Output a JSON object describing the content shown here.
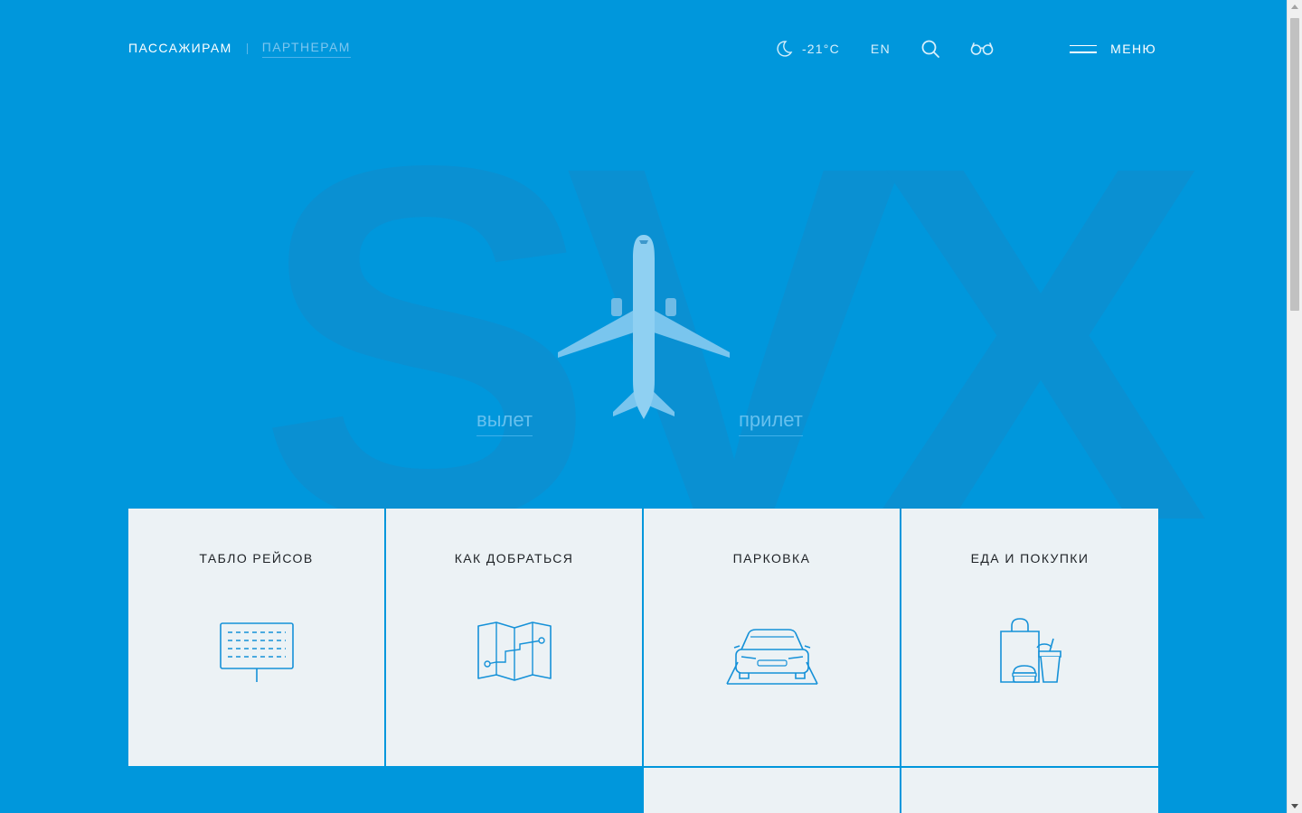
{
  "header": {
    "nav": [
      {
        "label": "ПАССАЖИРАМ",
        "active": true
      },
      {
        "label": "ПАРТНЕРАМ",
        "active": false
      }
    ],
    "weather": {
      "icon": "moon-icon",
      "temperature": "-21°C"
    },
    "language": "EN",
    "menu_label": "МЕНЮ"
  },
  "hero": {
    "background_letters": "SVX",
    "departure_label": "вылет",
    "arrival_label": "прилет"
  },
  "tiles": [
    {
      "title": "ТАБЛО РЕЙСОВ",
      "icon": "flight-board-icon"
    },
    {
      "title": "КАК ДОБРАТЬСЯ",
      "icon": "map-icon"
    },
    {
      "title": "ПАРКОВКА",
      "icon": "car-icon"
    },
    {
      "title": "ЕДА И ПОКУПКИ",
      "icon": "shopping-food-icon"
    }
  ],
  "colors": {
    "background": "#0097DC",
    "tile": "#ECF2F5",
    "icon_stroke": "#1591D8",
    "text_dark": "#1e2226"
  }
}
